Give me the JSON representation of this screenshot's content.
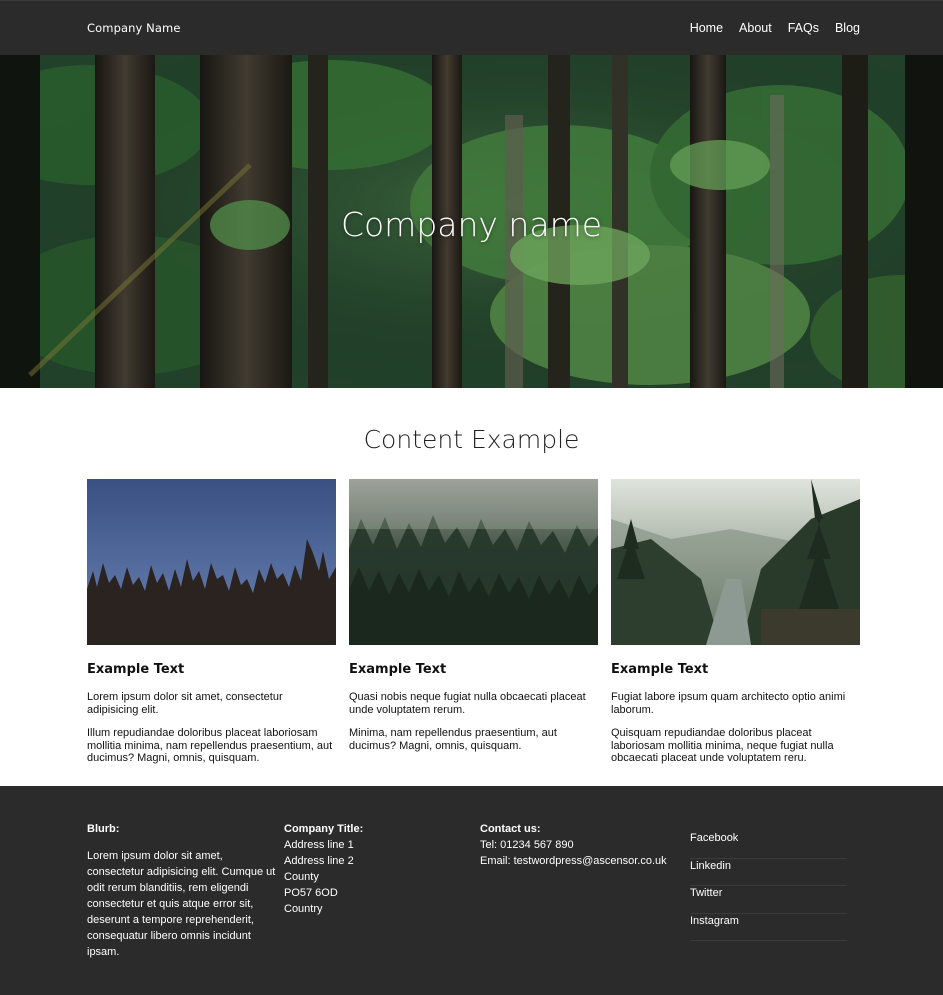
{
  "header": {
    "brand": "Company Name",
    "nav": [
      "Home",
      "About",
      "FAQs",
      "Blog"
    ]
  },
  "hero": {
    "title": "Company name"
  },
  "content": {
    "title": "Content Example",
    "cards": [
      {
        "heading": "Example Text",
        "p1": "Lorem ipsum dolor sit amet, consectetur adipisicing elit.",
        "p2": "Illum repudiandae doloribus placeat laboriosam mollitia minima, nam repellendus praesentium, aut ducimus? Magni, omnis, quisquam."
      },
      {
        "heading": "Example Text",
        "p1": "Quasi nobis neque fugiat nulla obcaecati placeat unde voluptatem rerum.",
        "p2": "Minima, nam repellendus praesentium, aut ducimus? Magni, omnis, quisquam."
      },
      {
        "heading": "Example Text",
        "p1": "Fugiat labore ipsum quam architecto optio animi laborum.",
        "p2": "Quisquam repudiandae doloribus placeat laboriosam mollitia minima, neque fugiat nulla obcaecati placeat unde voluptatem reru."
      }
    ]
  },
  "footer": {
    "blurb": {
      "heading": "Blurb:",
      "text": "Lorem ipsum dolor sit amet, consectetur adipisicing elit. Cumque ut odit rerum blanditiis, rem eligendi consectetur et quis atque error sit, deserunt a tempore reprehenderit, consequatur libero omnis incidunt ipsam."
    },
    "company": {
      "heading": "Company Title:",
      "lines": [
        "Address line 1",
        "Address line 2",
        "County",
        "PO57 6OD",
        "Country"
      ]
    },
    "contact": {
      "heading": "Contact us:",
      "tel": "Tel: 01234 567 890",
      "email": "Email: testwordpress@ascensor.co.uk"
    },
    "social": [
      "Facebook",
      "Linkedin",
      "Twitter",
      "Instagram"
    ]
  },
  "colors": {
    "header_bg": "#2b2b2b",
    "footer_bg": "#2b2b2b",
    "text_light": "#ffffff"
  }
}
